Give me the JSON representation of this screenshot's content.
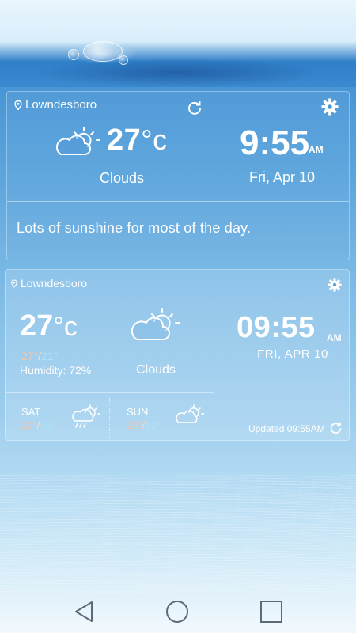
{
  "colors": {
    "accent_high": "#f3c6a8",
    "accent_low": "#a9e3f5",
    "text": "#ffffff"
  },
  "widget_large": {
    "location": "Lowndesboro",
    "temperature": "27",
    "unit": "°c",
    "condition": "Clouds",
    "time": "9:55",
    "ampm": "AM",
    "date": "Fri, Apr 10",
    "summary": "Lots of sunshine for most of the day.",
    "icons": [
      "location-pin-icon",
      "refresh-icon",
      "settings-gear-icon",
      "partly-sunny-cloud-icon"
    ]
  },
  "widget_small": {
    "location": "Lowndesboro",
    "temperature": "27",
    "unit": "°c",
    "high": "27°",
    "low": "21°",
    "humidity": "Humidity: 72%",
    "condition": "Clouds",
    "time": "09:55",
    "ampm": "AM",
    "date": "FRI, APR 10",
    "updated": "Updated 09:55AM",
    "forecast": [
      {
        "day": "SAT",
        "high": "22°",
        "low": "16°",
        "icon": "rain-sun-cloud-icon"
      },
      {
        "day": "SUN",
        "high": "22°",
        "low": "12°",
        "icon": "partly-sunny-cloud-icon"
      }
    ]
  },
  "navbar": {
    "buttons": [
      "back",
      "home",
      "recents"
    ]
  }
}
